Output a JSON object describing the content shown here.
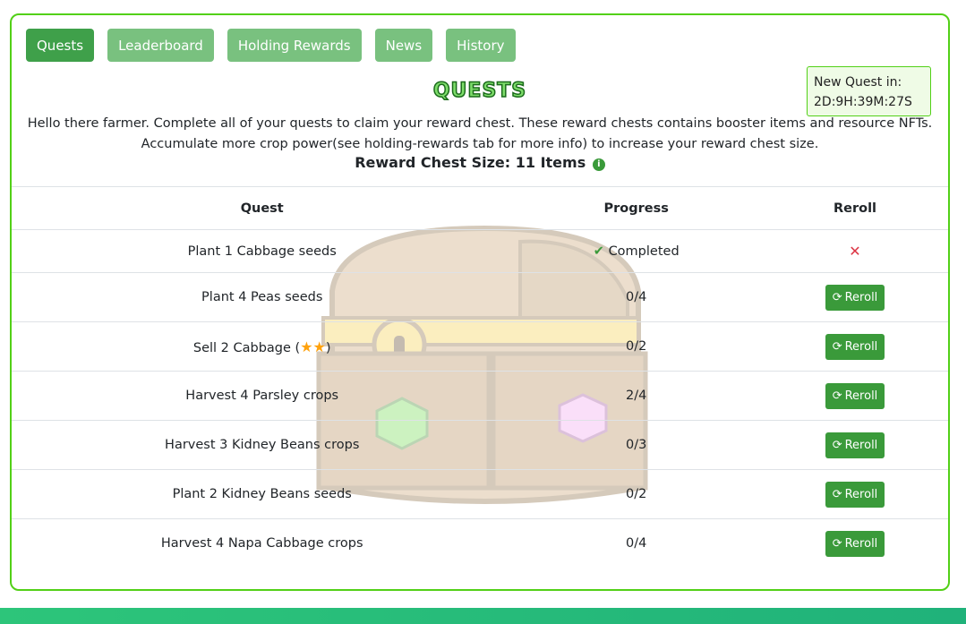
{
  "tabs": [
    {
      "label": "Quests",
      "active": true
    },
    {
      "label": "Leaderboard",
      "active": false
    },
    {
      "label": "Holding Rewards",
      "active": false
    },
    {
      "label": "News",
      "active": false
    },
    {
      "label": "History",
      "active": false
    }
  ],
  "timer": {
    "label": "New Quest in:",
    "value": "2D:9H:39M:27S"
  },
  "title": "QUESTS",
  "intro": {
    "line1": "Hello there farmer. Complete all of your quests to claim your reward chest. These reward chests contains booster items and resource NFTs.",
    "line2": "Accumulate more crop power(see holding-rewards tab for more info) to increase your reward chest size."
  },
  "chest_size": "Reward Chest Size: 11 Items",
  "table": {
    "headers": [
      "Quest",
      "Progress",
      "Reroll"
    ],
    "reroll_label": "Reroll",
    "completed_label": "Completed",
    "rows": [
      {
        "quest": "Plant 1 Cabbage seeds",
        "progress": "Completed"
      },
      {
        "quest": "Plant 4 Peas seeds",
        "progress": "0/4"
      },
      {
        "quest_prefix": "Sell 2 Cabbage (",
        "quest_suffix": ")",
        "stars": 2,
        "progress": "0/2"
      },
      {
        "quest": "Harvest 4 Parsley crops",
        "progress": "2/4"
      },
      {
        "quest": "Harvest 3 Kidney Beans crops",
        "progress": "0/3"
      },
      {
        "quest": "Plant 2 Kidney Beans seeds",
        "progress": "0/2"
      },
      {
        "quest": "Harvest 4 Napa Cabbage crops",
        "progress": "0/4"
      }
    ]
  },
  "colors": {
    "accent": "#3fa04a",
    "tab_inactive": "#79c17f",
    "border": "#52d017"
  }
}
